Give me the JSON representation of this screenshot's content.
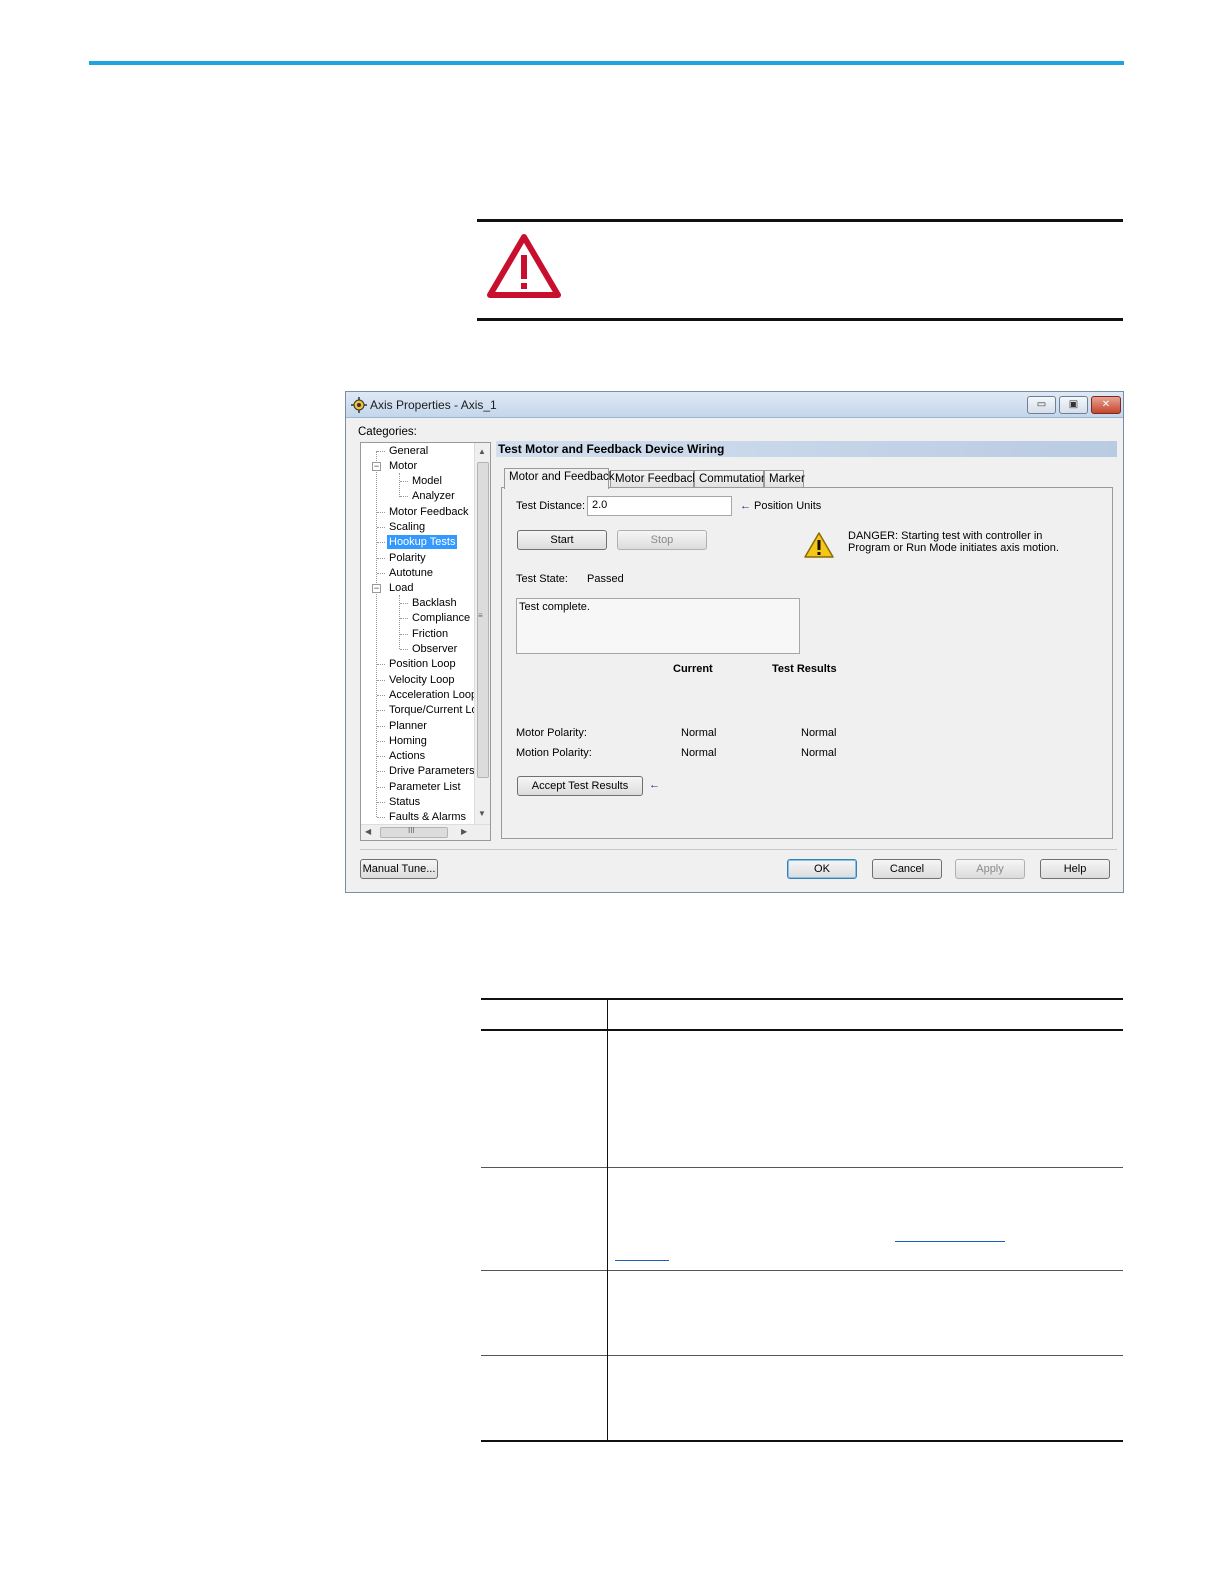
{
  "window": {
    "title": "Axis Properties - Axis_1",
    "min_glyph": "▭",
    "max_glyph": "▣",
    "close_glyph": "✕"
  },
  "categories_label": "Categories:",
  "tree": [
    {
      "label": "General"
    },
    {
      "label": "Motor"
    },
    {
      "label": "Model"
    },
    {
      "label": "Analyzer"
    },
    {
      "label": "Motor Feedback"
    },
    {
      "label": "Scaling"
    },
    {
      "label": "Hookup Tests",
      "selected": true
    },
    {
      "label": "Polarity"
    },
    {
      "label": "Autotune"
    },
    {
      "label": "Load"
    },
    {
      "label": "Backlash"
    },
    {
      "label": "Compliance"
    },
    {
      "label": "Friction"
    },
    {
      "label": "Observer"
    },
    {
      "label": "Position Loop"
    },
    {
      "label": "Velocity Loop"
    },
    {
      "label": "Acceleration Loop"
    },
    {
      "label": "Torque/Current Lo"
    },
    {
      "label": "Planner"
    },
    {
      "label": "Homing"
    },
    {
      "label": "Actions"
    },
    {
      "label": "Drive Parameters"
    },
    {
      "label": "Parameter List"
    },
    {
      "label": "Status"
    },
    {
      "label": "Faults & Alarms"
    }
  ],
  "scrollbar": {
    "grip": "≡",
    "hgrip": "III",
    "up": "▲",
    "down": "▼",
    "left": "◀",
    "right": "▶"
  },
  "section_title": "Test Motor and Feedback Device Wiring",
  "tabs": [
    "Motor and Feedback",
    "Motor Feedback",
    "Commutation",
    "Marker"
  ],
  "form": {
    "test_distance_label": "Test Distance:",
    "test_distance_value": "2.0",
    "units_arrow": "←",
    "units_label": "Position Units",
    "start_label": "Start",
    "stop_label": "Stop",
    "danger_text_1": "DANGER: Starting test with controller in",
    "danger_text_2": "Program or Run Mode initiates axis motion.",
    "test_state_label": "Test State:",
    "test_state_value": "Passed",
    "message": "Test complete.",
    "col_current": "Current",
    "col_results": "Test Results",
    "motor_polarity_label": "Motor Polarity:",
    "motor_polarity_current": "Normal",
    "motor_polarity_result": "Normal",
    "motion_polarity_label": "Motion Polarity:",
    "motion_polarity_current": "Normal",
    "motion_polarity_result": "Normal",
    "accept_label": "Accept Test Results",
    "accept_arrow": "←"
  },
  "footer": {
    "manual_tune": "Manual Tune...",
    "ok": "OK",
    "cancel": "Cancel",
    "apply": "Apply",
    "help": "Help"
  },
  "colors": {
    "accent_rule": "#1fa4e0",
    "attention_red": "#c8102e",
    "selection": "#3399ff"
  }
}
